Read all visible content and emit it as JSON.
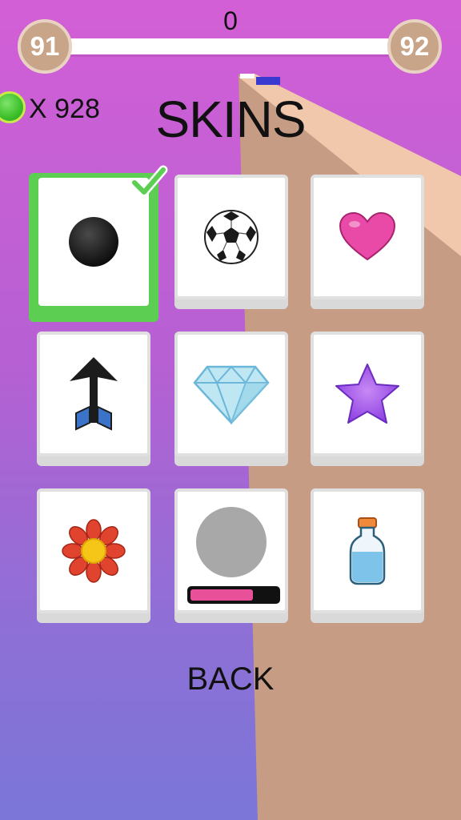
{
  "hud": {
    "score": "0",
    "current_level": "91",
    "next_level": "92",
    "coin_count": "X 928"
  },
  "title": "SKINS",
  "back_label": "BACK",
  "colors": {
    "selected": "#5ccf52",
    "track": "#c79c84",
    "coin": "#3cbf2a",
    "progress_fill": "#e8509a"
  },
  "skins": [
    {
      "name": "black ball",
      "icon": "black-ball-icon",
      "selected": true
    },
    {
      "name": "soccer ball",
      "icon": "soccer-ball-icon",
      "selected": false
    },
    {
      "name": "heart",
      "icon": "heart-icon",
      "selected": false
    },
    {
      "name": "arrow",
      "icon": "arrow-icon",
      "selected": false
    },
    {
      "name": "diamond",
      "icon": "diamond-icon",
      "selected": false
    },
    {
      "name": "star",
      "icon": "star-icon",
      "selected": false
    },
    {
      "name": "flower",
      "icon": "flower-icon",
      "selected": false
    },
    {
      "name": "locked",
      "icon": "locked-circle-icon",
      "locked": true,
      "unlock_progress": 0.72
    },
    {
      "name": "bottle",
      "icon": "bottle-icon",
      "selected": false
    }
  ]
}
